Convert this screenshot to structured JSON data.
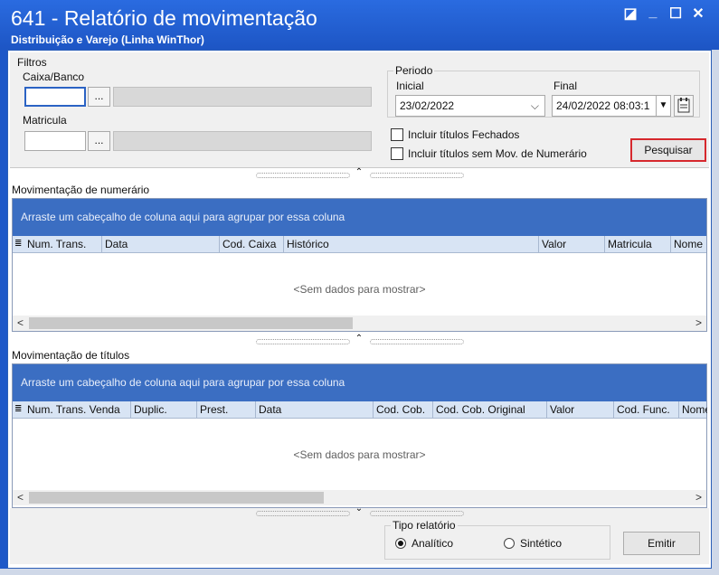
{
  "window": {
    "title": "641 - Relatório de movimentação",
    "subtitle": "Distribuição e Varejo (Linha WinThor)",
    "controls": {
      "restore": "◪",
      "minimize": "_",
      "maximize": "☐",
      "close": "✕"
    }
  },
  "filters": {
    "title": "Filtros",
    "caixa_banco_label": "Caixa/Banco",
    "matricula_label": "Matricula",
    "caixa_value": "",
    "matricula_value": "",
    "ellipsis_label": "..."
  },
  "periodo": {
    "title": "Periodo",
    "inicial_label": "Inicial",
    "inicial_value": "23/02/2022",
    "final_label": "Final",
    "final_value": "24/02/2022 08:03:1"
  },
  "options": {
    "incluir_fechados": "Incluir títulos Fechados",
    "incluir_sem_mov": "Incluir títulos sem Mov. de Numerário"
  },
  "search_button": "Pesquisar",
  "numerario": {
    "title": "Movimentação de numerário",
    "group_hint": "Arraste um cabeçalho de coluna aqui para agrupar por essa coluna",
    "columns": [
      "Num. Trans.",
      "Data",
      "Cod. Caixa",
      "Histórico",
      "Valor",
      "Matricula",
      "Nome"
    ],
    "empty_text": "<Sem dados para mostrar>"
  },
  "titulos": {
    "title": "Movimentação de títulos",
    "group_hint": "Arraste um cabeçalho de coluna aqui para agrupar por essa coluna",
    "columns": [
      "Num. Trans. Venda",
      "Duplic.",
      "Prest.",
      "Data",
      "Cod. Cob.",
      "Cod. Cob. Original",
      "Valor",
      "Cod. Func.",
      "Nome"
    ],
    "empty_text": "<Sem dados para mostrar>"
  },
  "tipo_relatorio": {
    "title": "Tipo relatório",
    "analitico": "Analítico",
    "sintetico": "Sintético",
    "selected": "Analítico"
  },
  "emitir_button": "Emitir",
  "icons": {
    "dropdown": "▼",
    "combo_chevron": "⌵",
    "scroll_left": "<",
    "scroll_right": ">",
    "split_up": "⌃",
    "split_down": "⌄",
    "grid_menu": "≣"
  }
}
